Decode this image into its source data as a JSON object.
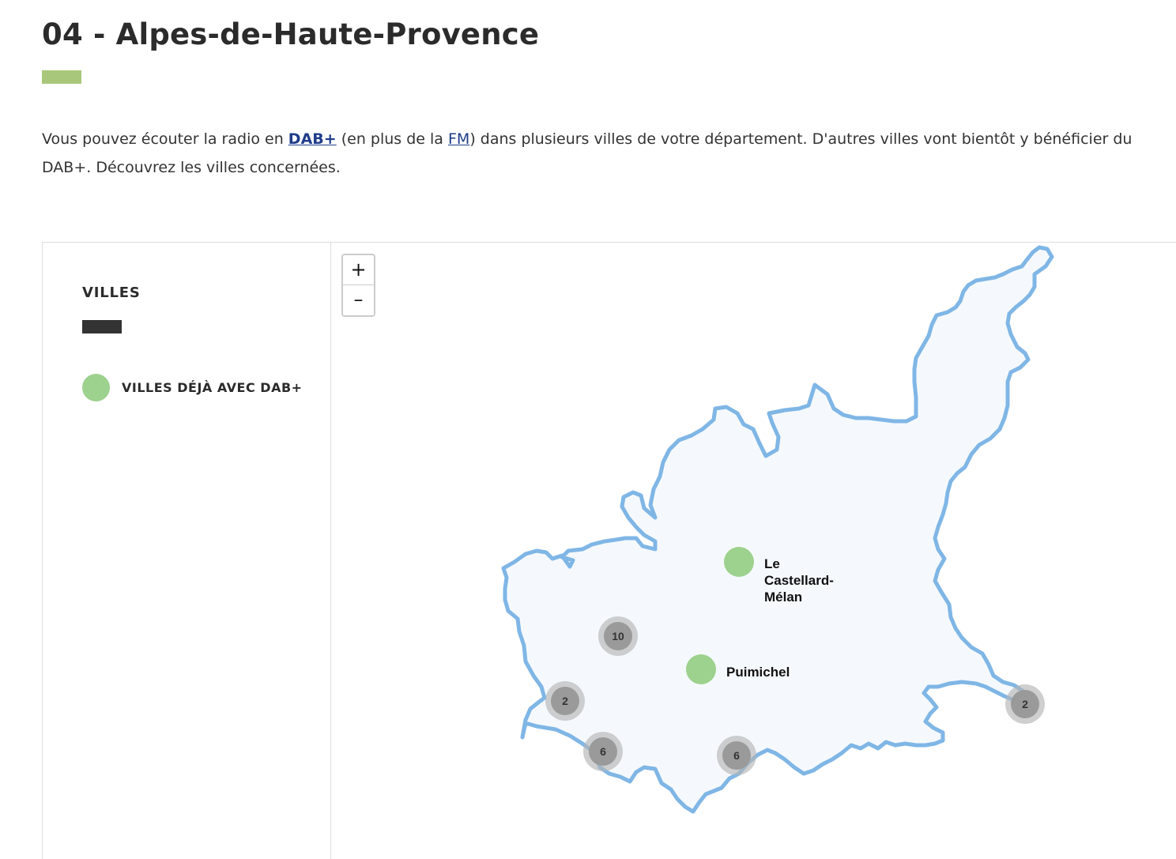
{
  "page": {
    "title": "04 - Alpes-de-Haute-Provence",
    "accent_color": "#a9c77a"
  },
  "intro": {
    "text_1": "Vous pouvez écouter la radio en ",
    "link_dab": "DAB+",
    "text_2": " (en plus de la ",
    "link_fm": "FM",
    "text_3": ") dans plusieurs villes de votre département. D'autres villes vont bientôt y bénéficier du DAB+. Découvrez les villes concernées."
  },
  "legend": {
    "title": "VILLES",
    "bar_color": "#333333",
    "items": [
      {
        "label": "VILLES DÉJÀ AVEC DAB+",
        "color": "#9dd18e"
      }
    ]
  },
  "map": {
    "zoom_in_label": "+",
    "zoom_out_label": "–",
    "border_color": "#7fb6e6",
    "fill_color": "#f5f9fd",
    "cities": [
      {
        "name_lines": [
          "Le",
          "Castellard-",
          "Mélan"
        ]
      },
      {
        "name_lines": [
          "Puimichel"
        ]
      }
    ],
    "clusters": [
      {
        "count": "10"
      },
      {
        "count": "2"
      },
      {
        "count": "6"
      },
      {
        "count": "6"
      },
      {
        "count": "2"
      }
    ]
  }
}
